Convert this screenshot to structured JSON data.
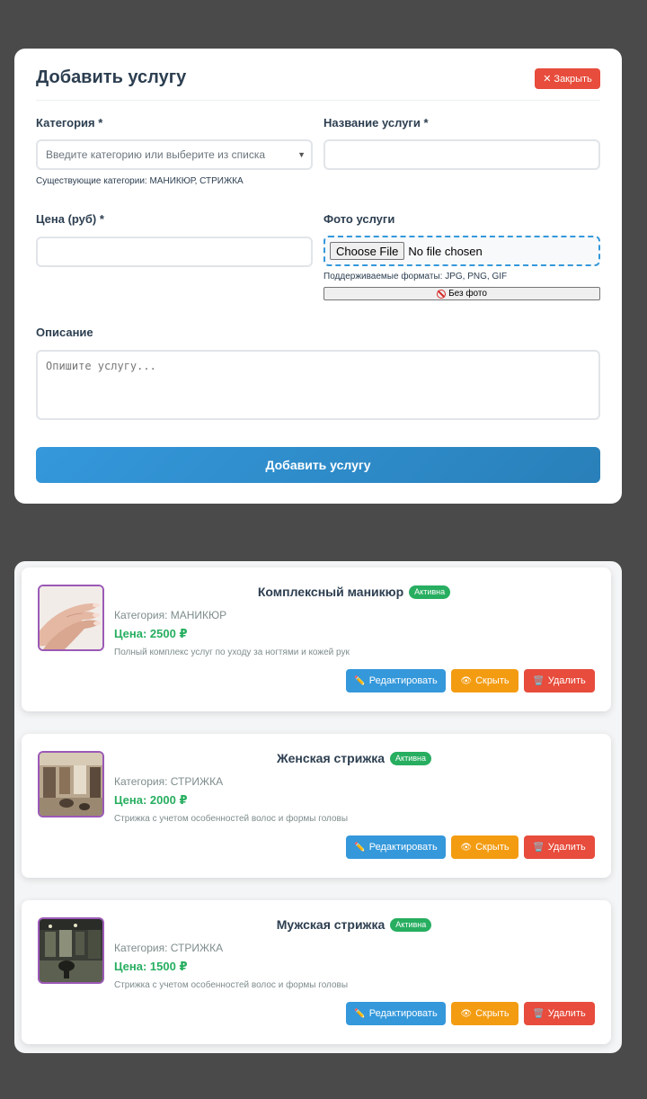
{
  "form": {
    "title": "Добавить услугу",
    "close_label": "Закрыть",
    "close_icon": "✕",
    "category_label": "Категория *",
    "category_placeholder": "Введите категорию или выберите из списка",
    "existing_categories": "Существующие категории: МАНИКЮР, СТРИЖКА",
    "name_label": "Название услуги *",
    "name_value": "",
    "price_label": "Цена (руб) *",
    "price_value": "",
    "photo_label": "Фото услуги",
    "choose_file_label": "Choose File",
    "no_file_text": "No file chosen",
    "formats_hint": "Поддерживаемые форматы: JPG, PNG, GIF",
    "no_photo_label": "Без фото",
    "description_label": "Описание",
    "description_placeholder": "Опишите услугу...",
    "submit_label": "Добавить услугу"
  },
  "services": [
    {
      "name": "Комплексный маникюр",
      "status": "Активна",
      "category": "Категория: МАНИКЮР",
      "price": "Цена: 2500 ₽",
      "description": "Полный комплекс услуг по уходу за ногтями и кожей рук",
      "image": "hands-manicure"
    },
    {
      "name": "Женская стрижка",
      "status": "Активна",
      "category": "Категория: СТРИЖКА",
      "price": "Цена: 2000 ₽",
      "description": "Стрижка с учетом особенностей волос и формы головы",
      "image": "salon-interior"
    },
    {
      "name": "Мужская стрижка",
      "status": "Активна",
      "category": "Категория: СТРИЖКА",
      "price": "Цена: 1500 ₽",
      "description": "Стрижка с учетом особенностей волос и формы головы",
      "image": "barbershop-interior"
    }
  ],
  "actions": {
    "edit_label": "Редактировать",
    "hide_label": "Скрыть",
    "delete_label": "Удалить",
    "edit_icon": "✏️",
    "hide_icon": "👁",
    "delete_icon": "🗑️"
  },
  "colors": {
    "primary": "#3498db",
    "danger": "#e74c3c",
    "warning": "#f39c12",
    "success": "#27ae60",
    "thumb_border": "#9b59b6"
  }
}
